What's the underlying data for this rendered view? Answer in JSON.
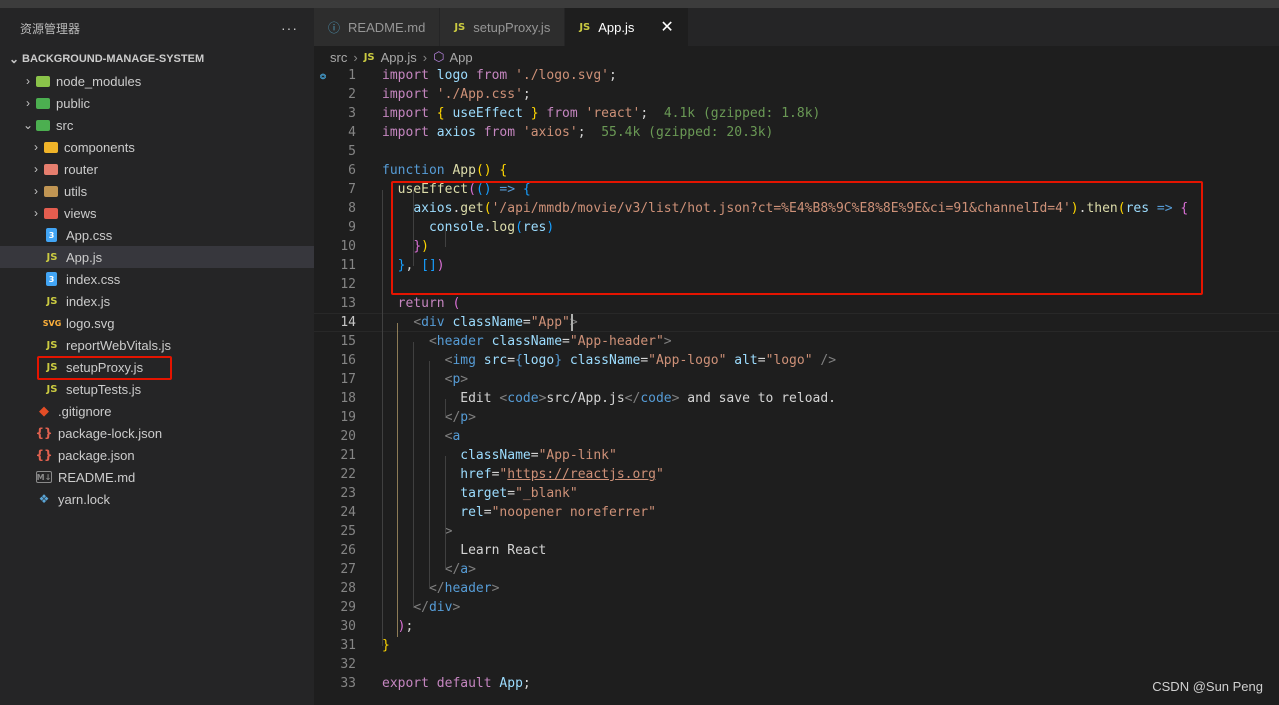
{
  "sidebar": {
    "title": "资源管理器",
    "more": "···",
    "root": "BACKGROUND-MANAGE-SYSTEM",
    "items": [
      {
        "label": "node_modules",
        "kind": "folder",
        "color": "#8bc34a",
        "depth": 0
      },
      {
        "label": "public",
        "kind": "folder",
        "color": "#4caf50",
        "depth": 0
      },
      {
        "label": "src",
        "kind": "folder-open",
        "color": "#4caf50",
        "depth": 0
      },
      {
        "label": "components",
        "kind": "folder",
        "color": "#f0b429",
        "depth": 1
      },
      {
        "label": "router",
        "kind": "folder",
        "color": "#e67e6e",
        "depth": 1
      },
      {
        "label": "utils",
        "kind": "folder",
        "color": "#c09553",
        "depth": 1
      },
      {
        "label": "views",
        "kind": "folder",
        "color": "#e45d4f",
        "depth": 1
      },
      {
        "label": "App.css",
        "kind": "css",
        "depth": 1
      },
      {
        "label": "App.js",
        "kind": "js",
        "depth": 1,
        "active": true
      },
      {
        "label": "index.css",
        "kind": "css",
        "depth": 1
      },
      {
        "label": "index.js",
        "kind": "js",
        "depth": 1
      },
      {
        "label": "logo.svg",
        "kind": "svg",
        "depth": 1
      },
      {
        "label": "reportWebVitals.js",
        "kind": "js",
        "depth": 1
      },
      {
        "label": "setupProxy.js",
        "kind": "js",
        "depth": 1,
        "highlighted": true
      },
      {
        "label": "setupTests.js",
        "kind": "js",
        "depth": 1
      },
      {
        "label": ".gitignore",
        "kind": "git",
        "depth": 0
      },
      {
        "label": "package-lock.json",
        "kind": "json",
        "depth": 0
      },
      {
        "label": "package.json",
        "kind": "json",
        "depth": 0
      },
      {
        "label": "README.md",
        "kind": "md",
        "depth": 0
      },
      {
        "label": "yarn.lock",
        "kind": "yarn",
        "depth": 0
      }
    ]
  },
  "tabs": [
    {
      "label": "README.md",
      "kind": "md",
      "active": false
    },
    {
      "label": "setupProxy.js",
      "kind": "js",
      "active": false
    },
    {
      "label": "App.js",
      "kind": "js",
      "active": true
    }
  ],
  "breadcrumb": {
    "folder": "src",
    "file": "App.js",
    "symbol": "App"
  },
  "editor": {
    "current_line": 14,
    "lines": [
      {
        "n": 1,
        "html": "<span class='kw'>import</span> <span class='var'>logo</span> <span class='kw'>from</span> <span class='str'>'./logo.svg'</span><span class='pun'>;</span>"
      },
      {
        "n": 2,
        "html": "<span class='kw'>import</span> <span class='str'>'./App.css'</span><span class='pun'>;</span>"
      },
      {
        "n": 3,
        "html": "<span class='kw'>import</span> <span class='b1'>{</span> <span class='var'>useEffect</span> <span class='b1'>}</span> <span class='kw'>from</span> <span class='str'>'react'</span><span class='pun'>;</span>  <span class='hint'>4.1k (gzipped: 1.8k)</span>"
      },
      {
        "n": 4,
        "html": "<span class='kw'>import</span> <span class='var'>axios</span> <span class='kw'>from</span> <span class='str'>'axios'</span><span class='pun'>;</span>  <span class='hint'>55.4k (gzipped: 20.3k)</span>"
      },
      {
        "n": 5,
        "html": ""
      },
      {
        "n": 6,
        "html": "<span class='kb'>function</span> <span class='fn'>App</span><span class='b1'>()</span> <span class='b1'>{</span>"
      },
      {
        "n": 7,
        "html": "  <span class='fn'>useEffect</span><span class='b2'>(</span><span class='b3'>()</span> <span class='kb'>=&gt;</span> <span class='b3'>{</span>"
      },
      {
        "n": 8,
        "html": "    <span class='var'>axios</span><span class='pun'>.</span><span class='fn'>get</span><span class='b1'>(</span><span class='str'>'/api/mmdb/movie/v3/list/hot.json?ct=%E4%B8%9C%E8%8E%9E&amp;ci=91&amp;channelId=4'</span><span class='b1'>)</span><span class='pun'>.</span><span class='fn'>then</span><span class='b1'>(</span><span class='var'>res</span> <span class='kb'>=&gt;</span> <span class='b2'>{</span>"
      },
      {
        "n": 9,
        "html": "      <span class='var'>console</span><span class='pun'>.</span><span class='fn'>log</span><span class='b3'>(</span><span class='var'>res</span><span class='b3'>)</span>"
      },
      {
        "n": 10,
        "html": "    <span class='b2'>}</span><span class='b1'>)</span>"
      },
      {
        "n": 11,
        "html": "  <span class='b3'>}</span><span class='pun'>,</span> <span class='b3'>[]</span><span class='b2'>)</span>"
      },
      {
        "n": 12,
        "html": ""
      },
      {
        "n": 13,
        "html": "  <span class='kw'>return</span> <span class='b2'>(</span>"
      },
      {
        "n": 14,
        "html": "    <span class='tgb'>&lt;</span><span class='tag'>div</span> <span class='var'>className</span><span class='pun'>=</span><span class='str'>\"App\"</span><span class='tgb'>&gt;</span>"
      },
      {
        "n": 15,
        "html": "      <span class='tgb'>&lt;</span><span class='tag'>header</span> <span class='var'>className</span><span class='pun'>=</span><span class='str'>\"App-header\"</span><span class='tgb'>&gt;</span>"
      },
      {
        "n": 16,
        "html": "        <span class='tgb'>&lt;</span><span class='tag'>img</span> <span class='var'>src</span><span class='pun'>=</span><span class='kb'>{</span><span class='var'>logo</span><span class='kb'>}</span> <span class='var'>className</span><span class='pun'>=</span><span class='str'>\"App-logo\"</span> <span class='var'>alt</span><span class='pun'>=</span><span class='str'>\"logo\"</span> <span class='tgb'>/&gt;</span>"
      },
      {
        "n": 17,
        "html": "        <span class='tgb'>&lt;</span><span class='tag'>p</span><span class='tgb'>&gt;</span>"
      },
      {
        "n": 18,
        "html": "          <span class='pun'>Edit </span><span class='tgb'>&lt;</span><span class='tag'>code</span><span class='tgb'>&gt;</span><span class='pun'>src/App.js</span><span class='tgb'>&lt;/</span><span class='tag'>code</span><span class='tgb'>&gt;</span><span class='pun'> and save to reload.</span>"
      },
      {
        "n": 19,
        "html": "        <span class='tgb'>&lt;/</span><span class='tag'>p</span><span class='tgb'>&gt;</span>"
      },
      {
        "n": 20,
        "html": "        <span class='tgb'>&lt;</span><span class='tag'>a</span>"
      },
      {
        "n": 21,
        "html": "          <span class='var'>className</span><span class='pun'>=</span><span class='str'>\"App-link\"</span>"
      },
      {
        "n": 22,
        "html": "          <span class='var'>href</span><span class='pun'>=</span><span class='str'>\"<span class='link'>https://reactjs.org</span>\"</span>"
      },
      {
        "n": 23,
        "html": "          <span class='var'>target</span><span class='pun'>=</span><span class='str'>\"_blank\"</span>"
      },
      {
        "n": 24,
        "html": "          <span class='var'>rel</span><span class='pun'>=</span><span class='str'>\"noopener noreferrer\"</span>"
      },
      {
        "n": 25,
        "html": "        <span class='tgb'>&gt;</span>"
      },
      {
        "n": 26,
        "html": "          <span class='pun'>Learn React</span>"
      },
      {
        "n": 27,
        "html": "        <span class='tgb'>&lt;/</span><span class='tag'>a</span><span class='tgb'>&gt;</span>"
      },
      {
        "n": 28,
        "html": "      <span class='tgb'>&lt;/</span><span class='tag'>header</span><span class='tgb'>&gt;</span>"
      },
      {
        "n": 29,
        "html": "    <span class='tgb'>&lt;/</span><span class='tag'>div</span><span class='tgb'>&gt;</span>"
      },
      {
        "n": 30,
        "html": "  <span class='b2'>)</span><span class='pun'>;</span>"
      },
      {
        "n": 31,
        "html": "<span class='b1'>}</span>"
      },
      {
        "n": 32,
        "html": ""
      },
      {
        "n": 33,
        "html": "<span class='kw'>export</span> <span class='kw'>default</span> <span class='var'>App</span><span class='pun'>;</span>"
      }
    ]
  },
  "watermark": "CSDN @Sun  Peng"
}
